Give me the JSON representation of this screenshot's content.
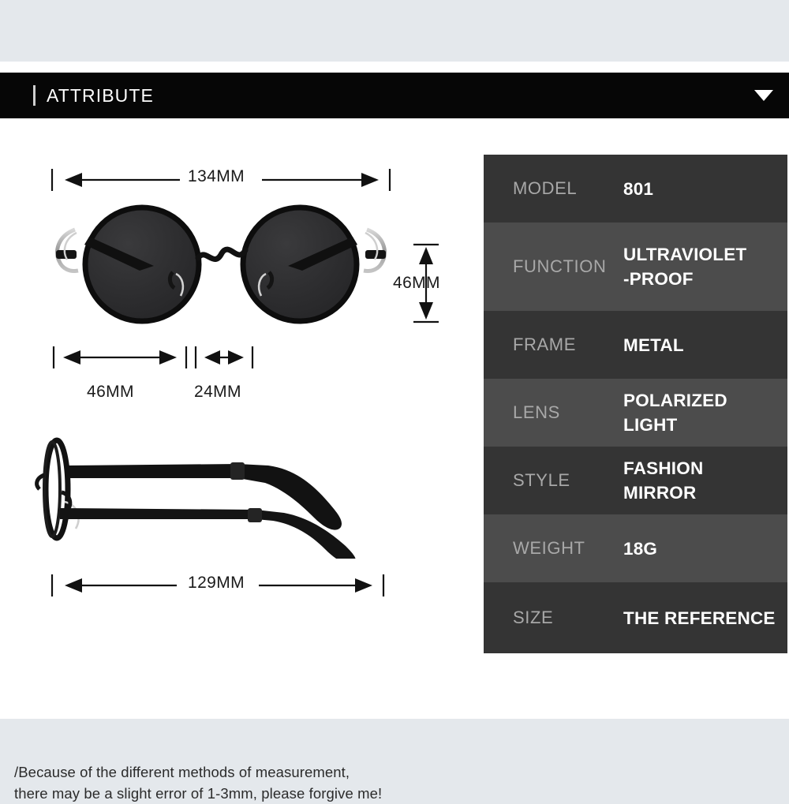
{
  "header": {
    "title": "ATTRIBUTE",
    "caret_icon": "chevron-down-icon",
    "background_color": "#060606",
    "accent_color": "#cfcfcf"
  },
  "page": {
    "background_color": "#e4e8ec",
    "sheet_color": "#ffffff"
  },
  "product": {
    "type": "round-metal-sunglasses",
    "frame_color": "#111111",
    "lens_color": "#2e2e30",
    "views": [
      {
        "name": "front-view",
        "alt": "Front view of round black metal sunglasses with wavy bridge"
      },
      {
        "name": "side-view",
        "alt": "Side view of sunglasses showing temple arms and curved tips"
      }
    ]
  },
  "dimensions": {
    "front_width": "134MM",
    "lens_height": "46MM",
    "lens_width": "46MM",
    "bridge_width": "24MM",
    "temple_length": "129MM"
  },
  "disclaimer": {
    "line1": "/Because of the different methods of measurement,",
    "line2": "there may be a slight error of 1-3mm, please forgive me!"
  },
  "spec_table": {
    "row_color_dark": "#343434",
    "row_color_light": "#4c4c4c",
    "label_color": "#a8a8a8",
    "value_color": "#ffffff",
    "rows": [
      {
        "label": "MODEL",
        "value": "801"
      },
      {
        "label": "FUNCTION",
        "value": "ULTRAVIOLET\n-PROOF"
      },
      {
        "label": "FRAME",
        "value": "METAL"
      },
      {
        "label": "LENS",
        "value": "POLARIZED LIGHT"
      },
      {
        "label": "STYLE",
        "value": "FASHION MIRROR"
      },
      {
        "label": "WEIGHT",
        "value": "18G"
      },
      {
        "label": "SIZE",
        "value": "THE REFERENCE"
      }
    ]
  }
}
